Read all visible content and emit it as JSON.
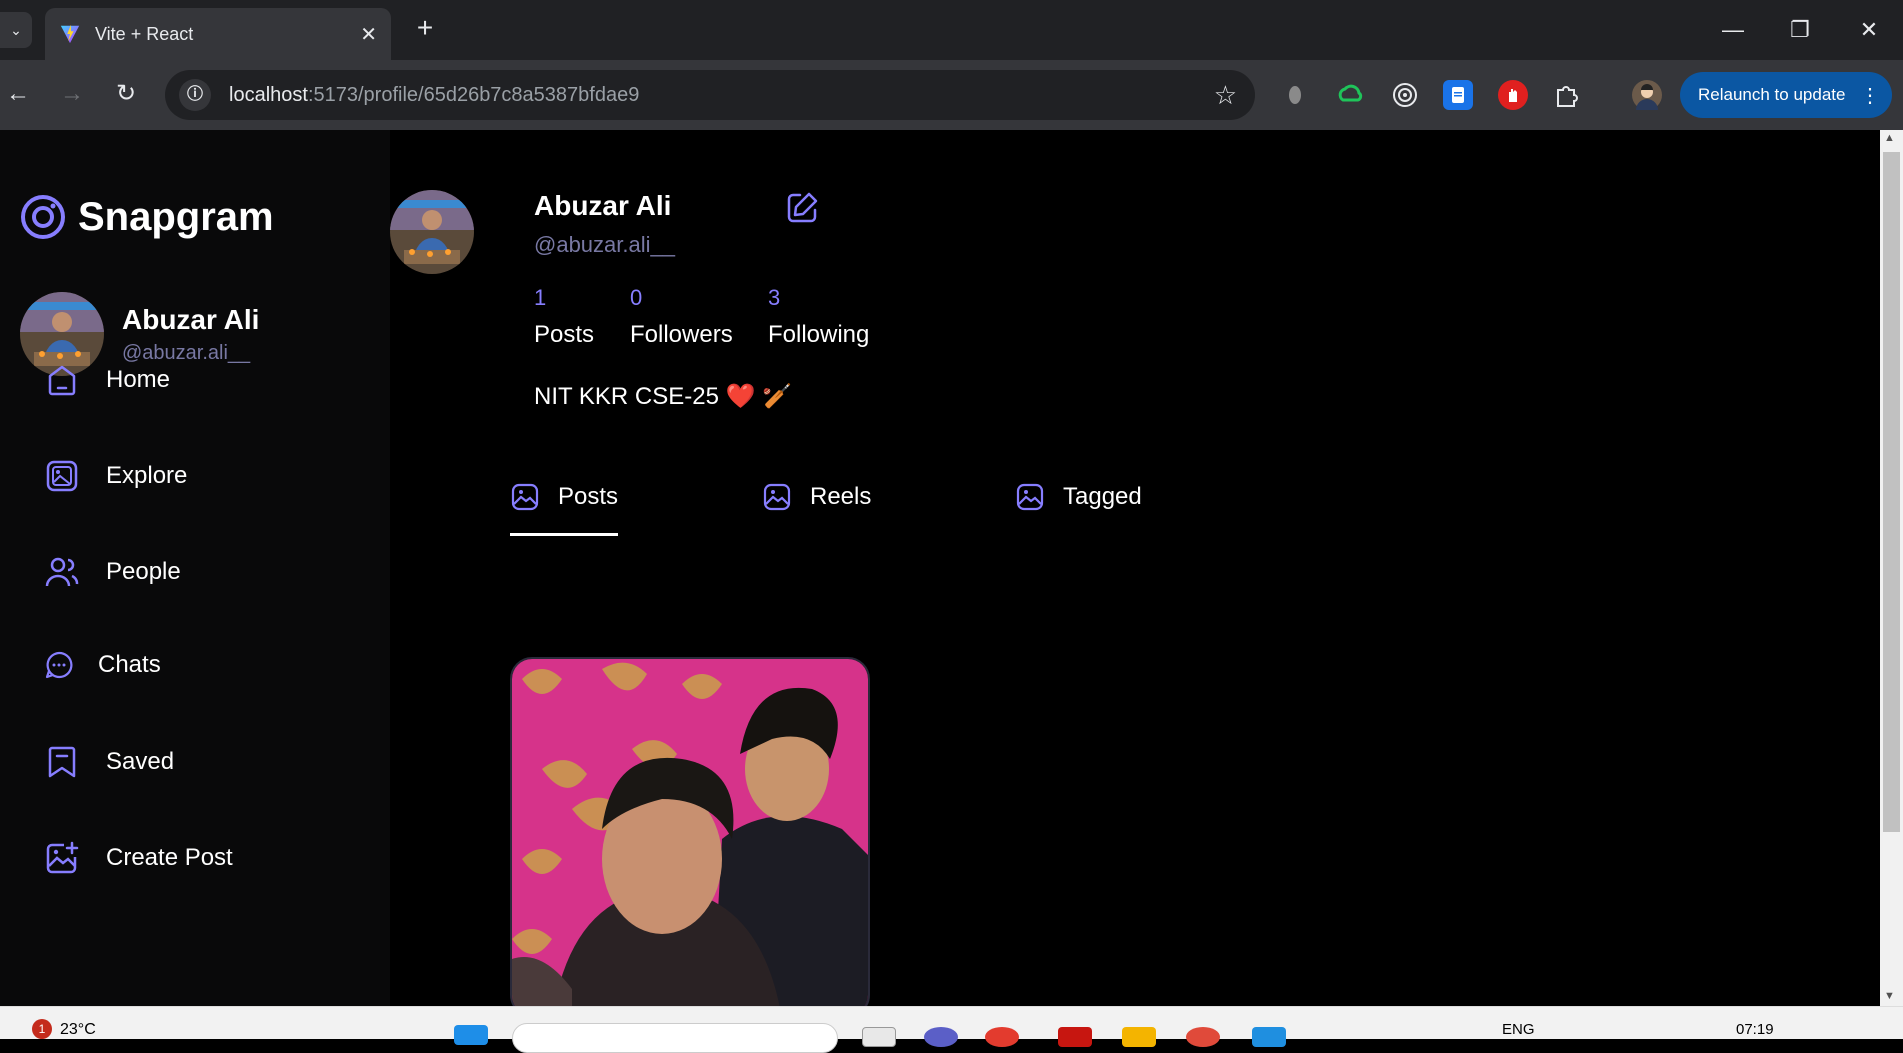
{
  "browser": {
    "tab_title": "Vite + React",
    "url_host": "localhost",
    "url_rest": ":5173/profile/65d26b7c8a5387bfdae9",
    "relaunch_label": "Relaunch to update"
  },
  "sidebar": {
    "brand": "Snapgram",
    "user": {
      "name": "Abuzar Ali",
      "handle": "@abuzar.ali__"
    },
    "items": [
      {
        "label": "Home",
        "icon": "home-icon"
      },
      {
        "label": "Explore",
        "icon": "gallery-icon"
      },
      {
        "label": "People",
        "icon": "people-icon"
      },
      {
        "label": "Chats",
        "icon": "chat-icon"
      },
      {
        "label": "Saved",
        "icon": "bookmark-icon"
      },
      {
        "label": "Create Post",
        "icon": "gallery-add-icon"
      }
    ]
  },
  "profile": {
    "name": "Abuzar Ali",
    "handle": "@abuzar.ali__",
    "stats": [
      {
        "value": "1",
        "label": "Posts"
      },
      {
        "value": "0",
        "label": "Followers"
      },
      {
        "value": "3",
        "label": "Following"
      }
    ],
    "bio": "NIT KKR CSE-25 ❤️ 🏏",
    "tabs": [
      {
        "label": "Posts",
        "active": true
      },
      {
        "label": "Reels",
        "active": false
      },
      {
        "label": "Tagged",
        "active": false
      }
    ]
  },
  "taskbar": {
    "weather": "23°C",
    "notification_count": "1",
    "language": "ENG",
    "time": "07:19"
  },
  "colors": {
    "accent": "#877eff",
    "muted": "#7878a3",
    "sidebar_bg": "#09090a"
  }
}
